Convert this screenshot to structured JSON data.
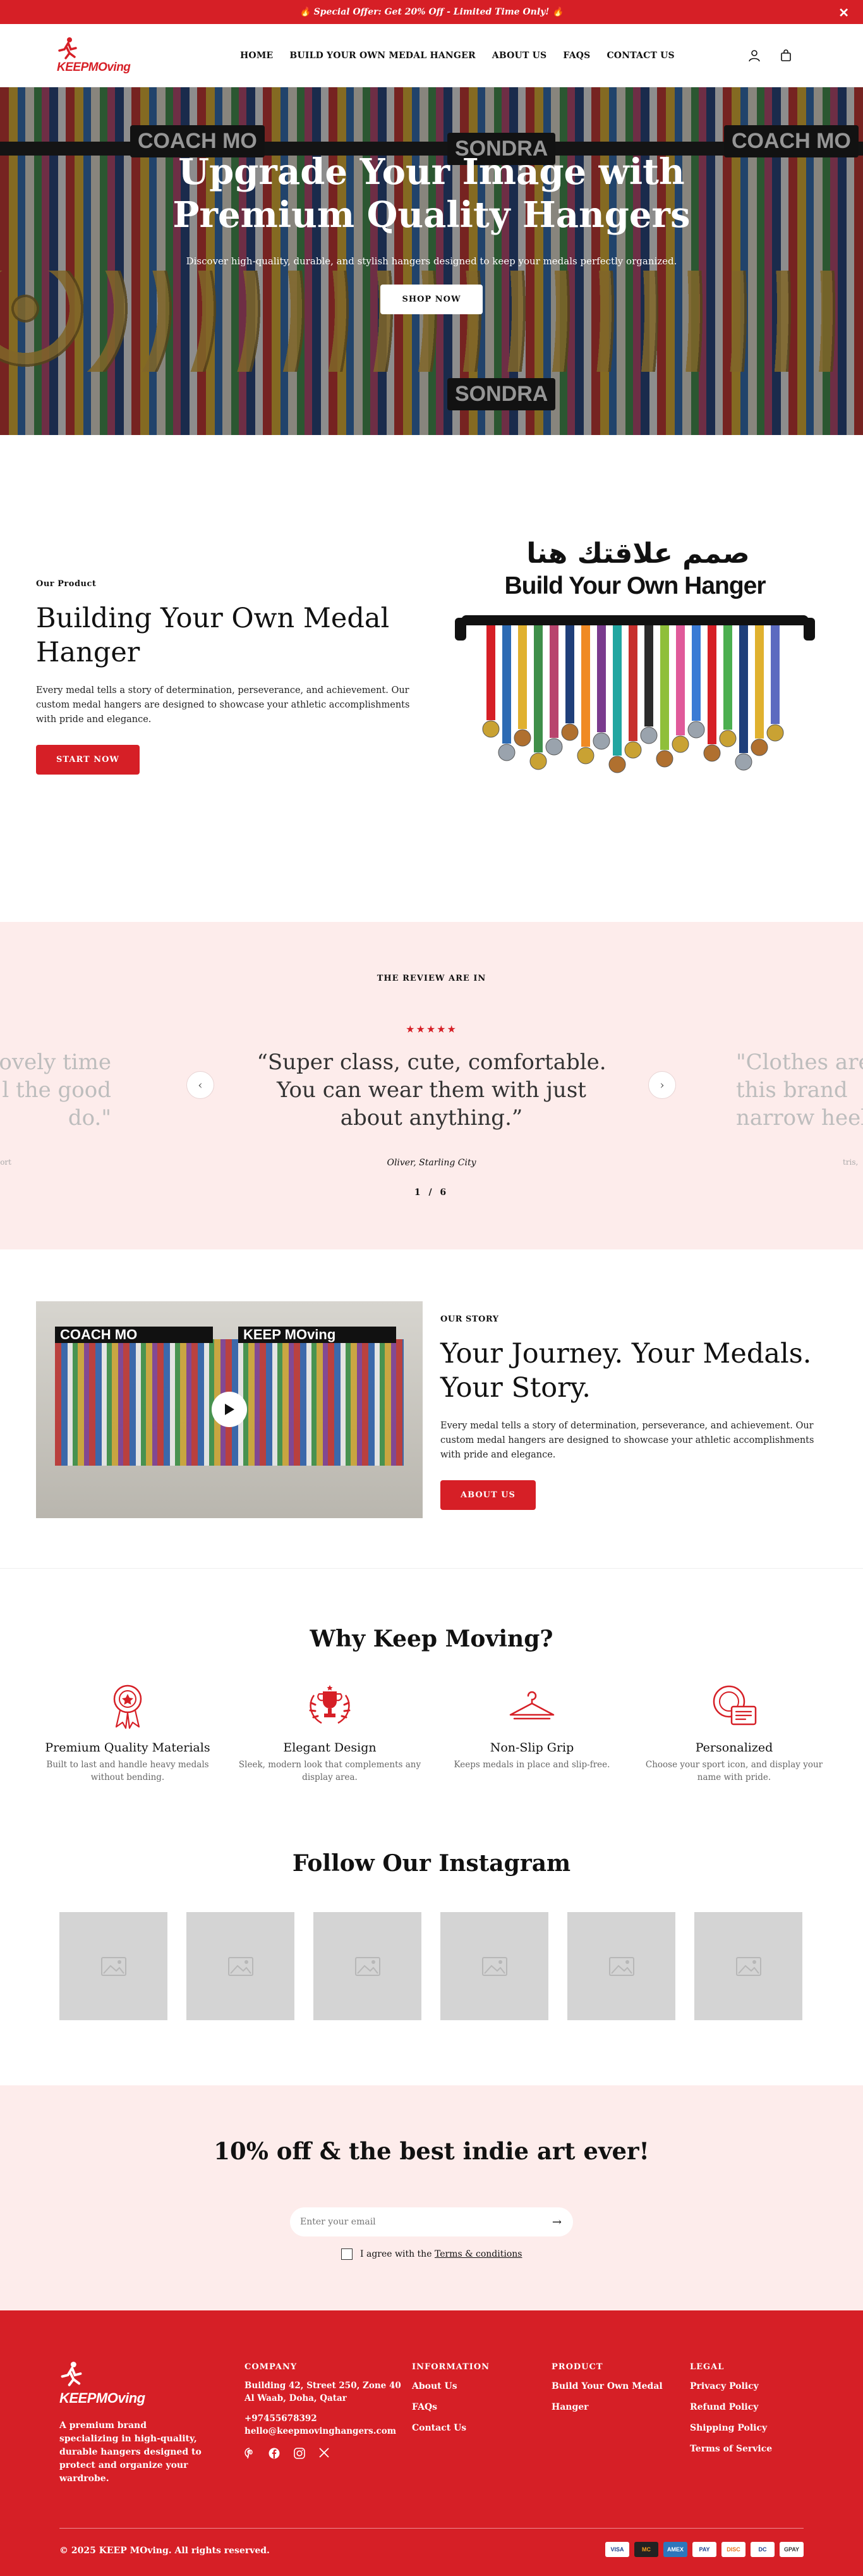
{
  "announcement": {
    "text": "🔥 Special Offer: Get 20% Off - Limited Time Only! 🔥",
    "close": "✕"
  },
  "brand": {
    "name": "KEEPMOving"
  },
  "nav": [
    "HOME",
    "BUILD YOUR OWN MEDAL HANGER",
    "ABOUT US",
    "FAQS",
    "CONTACT US"
  ],
  "icons": {
    "account": "user-icon",
    "cart": "bag-icon"
  },
  "hero": {
    "title_line1": "Upgrade Your Image with",
    "title_line2": "Premium Quality Hangers",
    "subtitle": "Discover high-quality, durable, and stylish hangers designed to keep your medals perfectly organized.",
    "button": "SHOP NOW",
    "sign1": "COACH MO",
    "sign2": "SONDRA",
    "sign3": "SONDRA",
    "sign4": "COACH MO"
  },
  "build": {
    "eyebrow": "Our Product",
    "title_line1": "Building Your Own Medal",
    "title_line2": "Hanger",
    "text": "Every medal tells a story of determination, perseverance, and achievement. Our custom medal hangers are designed to showcase your athletic accomplishments with pride and elegance.",
    "button": "START NOW",
    "image_arabic": "صمم علاقتك هنا",
    "image_title": "Build Your Own Hanger"
  },
  "reviews": {
    "title": "THE REVIEW ARE IN",
    "stars": "★★★★★",
    "quote_line1": "“Super class, cute, comfortable.",
    "quote_line2": "You can wear them with just",
    "quote_line3": "about anything.”",
    "author_name": "Oliver",
    "author_sep": ", ",
    "author_place": "Starling City",
    "left_quote_line1": "ovely time",
    "left_quote_line2": "l the good",
    "left_quote_line3": "do.\"",
    "left_author": "ort",
    "right_quote_line1": "\"Clothes are",
    "right_quote_line2": "this brand",
    "right_quote_line3": "narrow heel",
    "right_author": "tris,",
    "pager": "1 / 6",
    "prev": "‹",
    "next": "›"
  },
  "story": {
    "eyebrow": "OUR STORY",
    "title_line1": "Your Journey. Your Medals.",
    "title_line2": "Your Story.",
    "text": "Every medal tells a story of determination, perseverance, and achievement. Our custom medal hangers are designed to showcase your athletic accomplishments with pride and elegance.",
    "button": "ABOUT US",
    "video_sign1": "COACH MO",
    "video_sign2": "KEEP MOving"
  },
  "features": {
    "title": "Why Keep Moving?",
    "items": [
      {
        "title": "Premium Quality Materials",
        "desc": "Built to last and handle heavy medals without bending.",
        "icon": "award-ribbon-icon"
      },
      {
        "title": "Elegant Design",
        "desc": "Sleek, modern look that complements any display area.",
        "icon": "trophy-laurel-icon"
      },
      {
        "title": "Non-Slip Grip",
        "desc": "Keeps medals in place and slip-free.",
        "icon": "hanger-icon"
      },
      {
        "title": "Personalized",
        "desc": "Choose your sport icon, and display your name with pride.",
        "icon": "personalized-card-icon"
      }
    ],
    "accent": "#d61f26"
  },
  "instagram": {
    "title": "Follow Our Instagram",
    "tiles": 6
  },
  "newsletter": {
    "title": "10% off & the best indie art ever!",
    "placeholder": "Enter your email",
    "agree_prefix": "I agree with the ",
    "agree_link": "Terms & conditions"
  },
  "footer": {
    "description": "A premium brand specializing in high-quality, durable hangers designed to protect and organize your wardrobe.",
    "company": {
      "heading": "COMPANY",
      "address_line1": "Building 42, Street 250, Zone 40",
      "address_line2": "Al Waab, Doha, Qatar",
      "phone": "+97455678392",
      "email": "hello@keepmovinghangers.com"
    },
    "information": {
      "heading": "INFORMATION",
      "links": [
        "About Us",
        "FAQs",
        "Contact Us"
      ]
    },
    "product": {
      "heading": "PRODUCT",
      "link_line1": "Build Your Own Medal",
      "link_line2": "Hanger"
    },
    "legal": {
      "heading": "LEGAL",
      "links": [
        "Privacy Policy",
        "Refund Policy",
        "Shipping Policy",
        "Terms of Service"
      ]
    },
    "socials": [
      "pinterest-icon",
      "facebook-icon",
      "instagram-icon",
      "x-icon"
    ],
    "copyright": "© 2025 KEEP MOving. All rights reserved.",
    "payments": [
      "VISA",
      "MC",
      "AMEX",
      "PAY",
      "DISC",
      "DC",
      "GPAY"
    ]
  },
  "colors": {
    "brand_red": "#d61f26",
    "blush": "#fdeceb"
  }
}
